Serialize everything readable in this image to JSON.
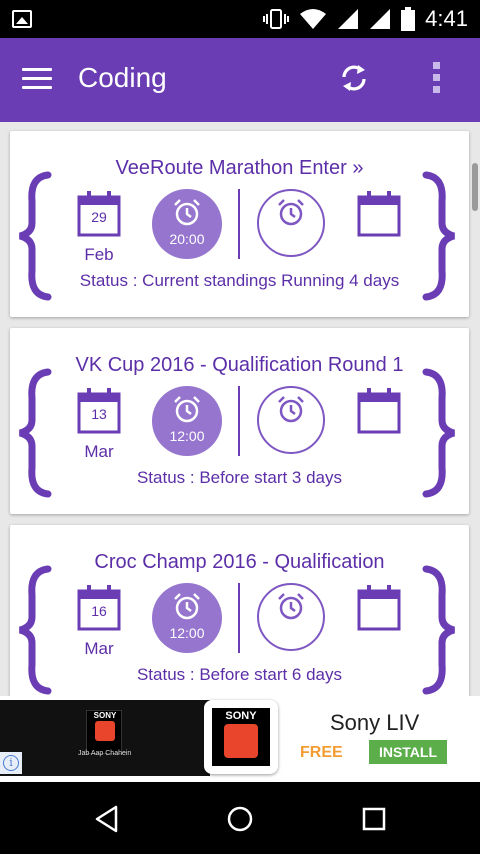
{
  "status_bar": {
    "time": "4:41",
    "icons": [
      "image-icon",
      "vibrate-icon",
      "wifi-icon",
      "signal-icon",
      "signal-icon",
      "battery-icon"
    ]
  },
  "app_bar": {
    "title": "Coding",
    "background": "#6a3db5",
    "icons": [
      "menu-icon",
      "refresh-icon",
      "overflow-icon"
    ]
  },
  "contests": [
    {
      "title": "VeeRoute Marathon Enter »",
      "start_day": "29",
      "start_month": "Feb",
      "start_time": "20:00",
      "status": "Status : Current standings Running 4 days"
    },
    {
      "title": "VK Cup 2016 - Qualification Round 1",
      "start_day": "13",
      "start_month": "Mar",
      "start_time": "12:00",
      "status": "Status : Before start 3 days"
    },
    {
      "title": "Croc Champ 2016 - Qualification",
      "start_day": "16",
      "start_month": "Mar",
      "start_time": "12:00",
      "status": "Status : Before start 6 days"
    }
  ],
  "ad": {
    "brand_small": "SONY",
    "tagline": "Jab Aap Chahein",
    "brand_big": "SONY",
    "app_name": "Sony LIV",
    "price": "FREE",
    "install_label": "INSTALL",
    "info_glyph": "i",
    "accent_free": "#f39c34",
    "accent_install": "#5cae4a"
  },
  "nav_bar": {
    "icons": [
      "back-icon",
      "home-icon",
      "recents-icon"
    ]
  }
}
